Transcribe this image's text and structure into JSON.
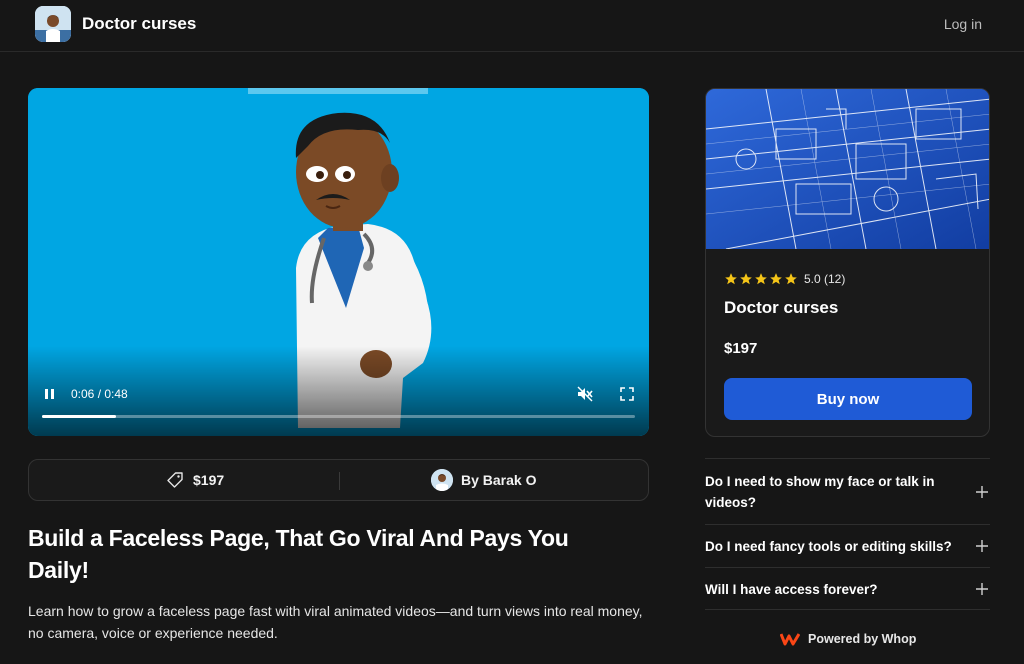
{
  "header": {
    "brand_name": "Doctor curses",
    "login_label": "Log in"
  },
  "video": {
    "time": "0:06 / 0:48",
    "progress": 0.125
  },
  "info_bar": {
    "price": "$197",
    "author": "By Barak O"
  },
  "product": {
    "title": "Build a Faceless Page, That Go Viral And Pays You Daily!",
    "description": "Learn how to grow a faceless page fast with viral animated videos—and turn views into real money, no camera, voice or experience needed."
  },
  "card": {
    "rating_text": "5.0 (12)",
    "stars": 5,
    "title": "Doctor curses",
    "price": "$197",
    "buy_label": "Buy now"
  },
  "faq": [
    {
      "question": "Do I need to show my face or talk in videos?"
    },
    {
      "question": "Do I need fancy tools or editing skills?"
    },
    {
      "question": "Will I have access forever?"
    }
  ],
  "footer": {
    "powered_by": "Powered by Whop"
  },
  "colors": {
    "background": "#161616",
    "accent": "#1f5bd6",
    "video_bg": "#00a6e3",
    "star": "#f5c518",
    "whop": "#fa4616"
  }
}
